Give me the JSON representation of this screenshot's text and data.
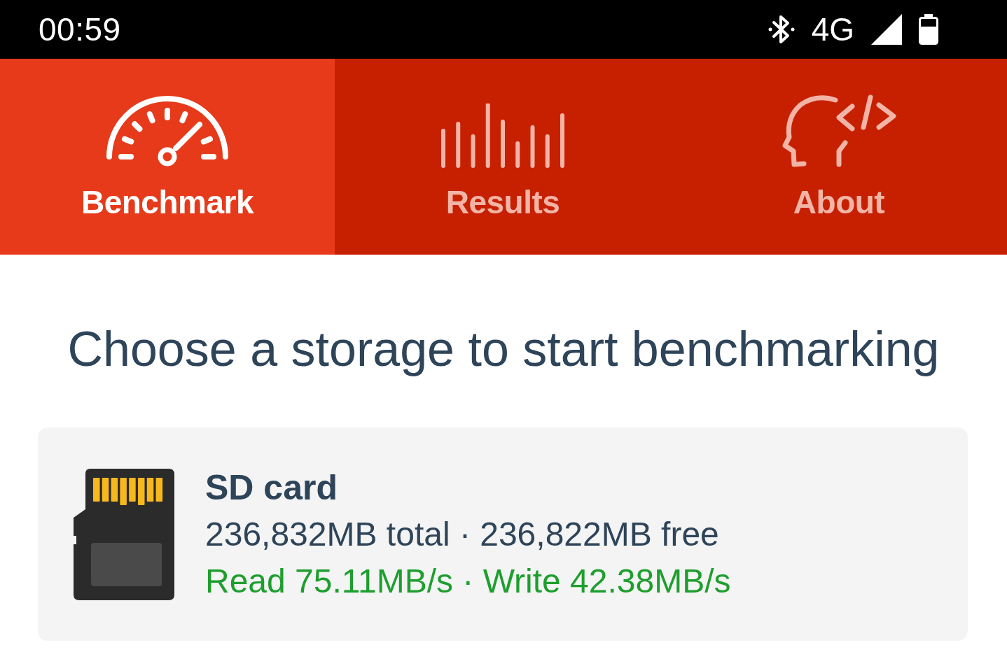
{
  "status_bar": {
    "time": "00:59",
    "network": "4G"
  },
  "tabs": [
    {
      "label": "Benchmark",
      "selected": true,
      "kind": "gauge"
    },
    {
      "label": "Results",
      "selected": false,
      "kind": "bars"
    },
    {
      "label": "About",
      "selected": false,
      "kind": "developer"
    }
  ],
  "heading": "Choose a storage to start benchmarking",
  "storages": [
    {
      "name": "SD card",
      "capacity": "236,832MB total · 236,822MB free",
      "speed": "Read 75.11MB/s · Write 42.38MB/s"
    }
  ]
}
